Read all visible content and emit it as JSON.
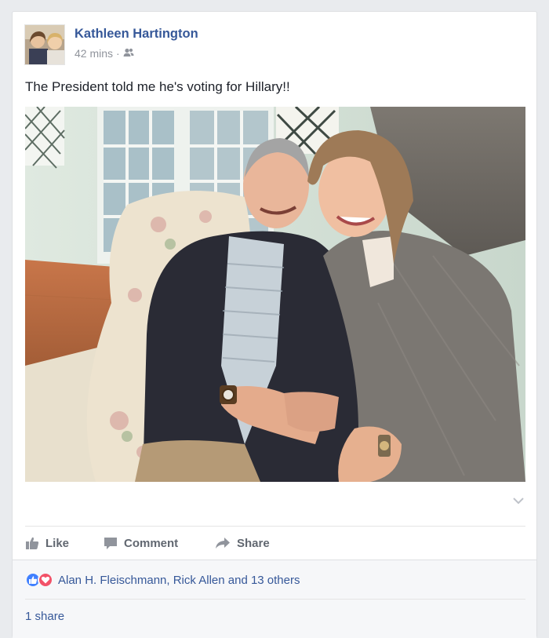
{
  "post": {
    "author": "Kathleen Hartington",
    "time": "42 mins",
    "separator": "·",
    "audience_icon": "friends-icon",
    "text": "The President told me he's voting for Hillary!!",
    "photo_subject": "people-photo"
  },
  "actions": {
    "like": "Like",
    "comment": "Comment",
    "share": "Share"
  },
  "reactions": {
    "icons": [
      "like-reaction-icon",
      "love-reaction-icon"
    ],
    "names": "Alan H. Fleischmann, Rick Allen and 13 others"
  },
  "shares": {
    "count_label": "1 share"
  },
  "colors": {
    "link_blue": "#365899",
    "like_blue": "#4080ff",
    "love_red": "#f25268",
    "action_gray": "#616770",
    "meta_gray": "#90949c",
    "footer_bg": "#f6f7f9"
  }
}
